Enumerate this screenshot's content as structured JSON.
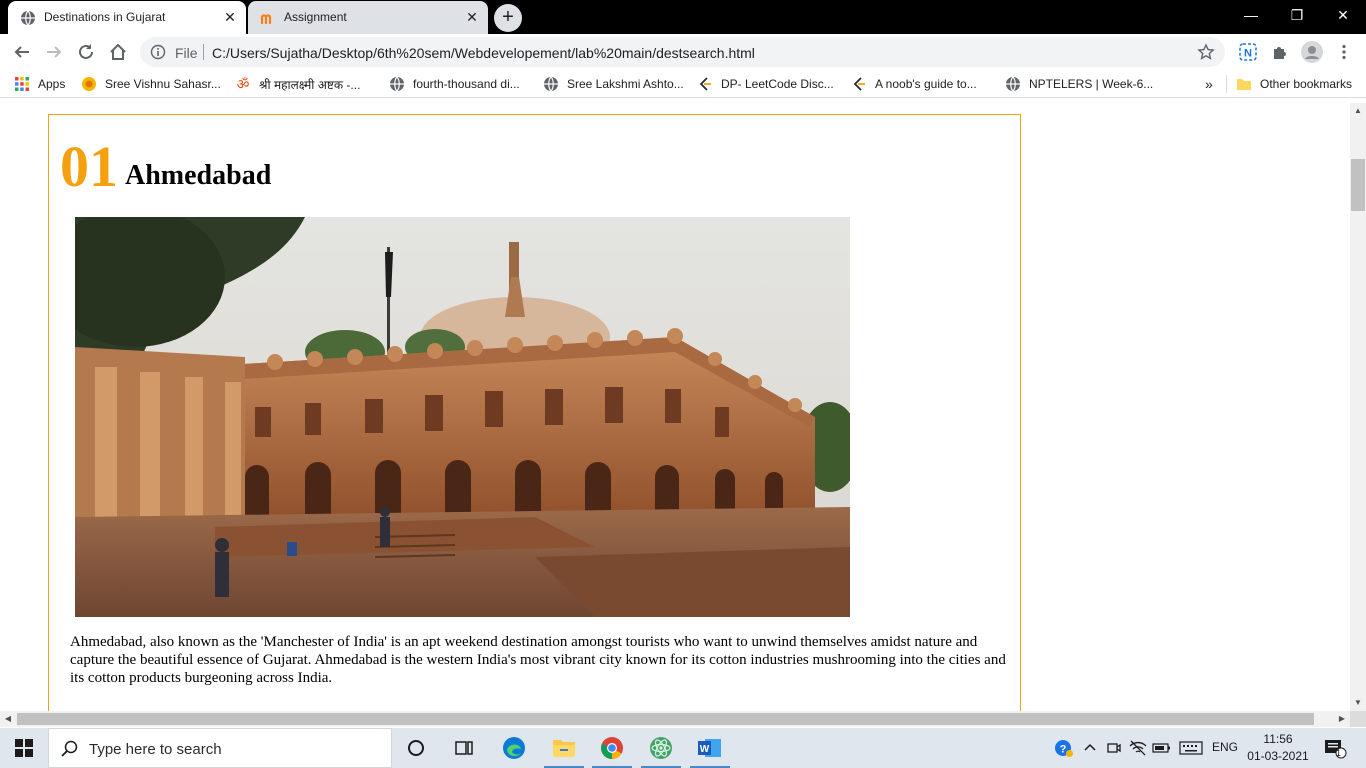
{
  "browser": {
    "tabs": [
      {
        "title": "Destinations in Gujarat",
        "active": true,
        "favicon": "globe-icon"
      },
      {
        "title": "Assignment",
        "active": false,
        "favicon": "moodle-icon"
      }
    ],
    "address": {
      "scheme_label": "File",
      "url": "C:/Users/Sujatha/Desktop/6th%20sem/Webdevelopement/lab%20main/destsearch.html"
    },
    "bookmarks": [
      {
        "label": "Apps",
        "icon": "apps-grid-icon"
      },
      {
        "label": "Sree Vishnu Sahasr...",
        "icon": "sun-icon"
      },
      {
        "label": "श्री महालक्ष्मी अष्टक -...",
        "icon": "om-icon"
      },
      {
        "label": "fourth-thousand di...",
        "icon": "globe-icon"
      },
      {
        "label": "Sree Lakshmi Ashto...",
        "icon": "globe-icon"
      },
      {
        "label": "DP- LeetCode Disc...",
        "icon": "leetcode-icon"
      },
      {
        "label": "A noob's guide to...",
        "icon": "leetcode-icon"
      },
      {
        "label": "NPTELERS | Week-6...",
        "icon": "globe-icon"
      }
    ],
    "bookmarks_overflow": "»",
    "other_bookmarks": "Other bookmarks",
    "colors": {
      "accent": "#f5a00f",
      "frame": "#000000",
      "omnibox": "#f1f3f4"
    }
  },
  "page": {
    "number": "01",
    "city": "Ahmedabad",
    "image_subject": "Ahmedabad monument photograph",
    "description": "Ahmedabad, also known as the 'Manchester of India' is an apt weekend destination amongst tourists who want to unwind themselves amidst nature and capture the beautiful essence of Gujarat. Ahmedabad is the western India's most vibrant city known for its cotton industries mushrooming into the cities and its cotton products burgeoning across India."
  },
  "taskbar": {
    "search_placeholder": "Type here to search",
    "language": "ENG",
    "time": "11:56",
    "date": "01-03-2021",
    "notification_count": "1"
  }
}
